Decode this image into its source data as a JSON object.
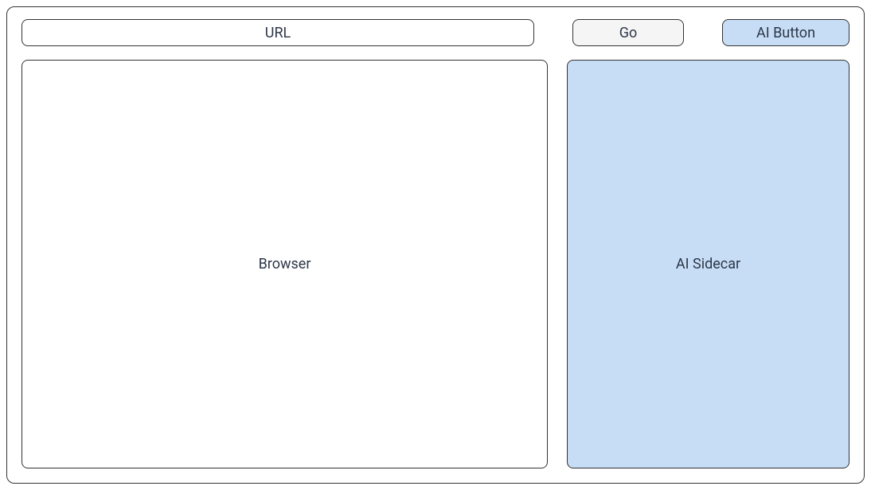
{
  "topbar": {
    "url_placeholder": "URL",
    "go_label": "Go",
    "ai_button_label": "AI Button"
  },
  "main": {
    "browser_label": "Browser",
    "sidecar_label": "AI Sidecar"
  },
  "colors": {
    "accent_blue": "#c6ddf5",
    "neutral_gray": "#f5f5f5",
    "border": "#333333",
    "text": "#2d3748"
  }
}
